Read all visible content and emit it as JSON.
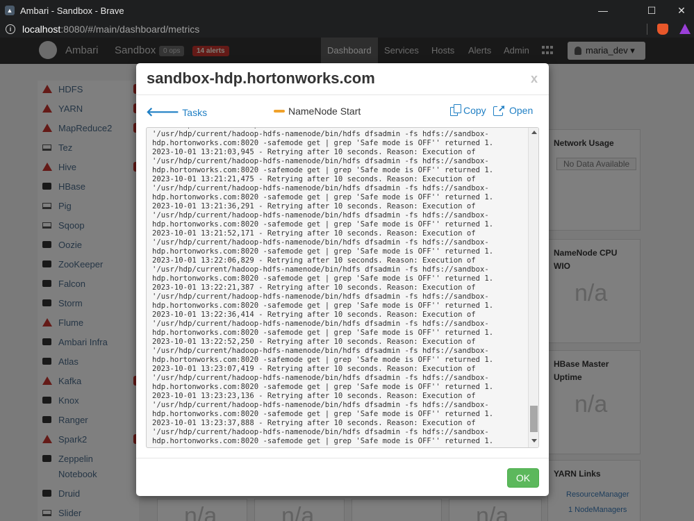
{
  "browser": {
    "window_title": "Ambari - Sandbox - Brave",
    "url_host": "localhost",
    "url_path": ":8080/#/main/dashboard/metrics",
    "minimize": "—",
    "maximize": "☐",
    "close": "✕"
  },
  "app": {
    "brand": "Ambari",
    "cluster": "Sandbox",
    "ops_badge": "0 ops",
    "alerts_badge": "14 alerts",
    "nav": [
      "Dashboard",
      "Services",
      "Hosts",
      "Alerts",
      "Admin"
    ],
    "user": "maria_dev ▾"
  },
  "sidebar": {
    "services": [
      {
        "label": "HDFS",
        "icon": "warning-icon"
      },
      {
        "label": "YARN",
        "icon": "warning-icon"
      },
      {
        "label": "MapReduce2",
        "icon": "warning-icon"
      },
      {
        "label": "Tez",
        "icon": "laptop-icon"
      },
      {
        "label": "Hive",
        "icon": "warning-icon"
      },
      {
        "label": "HBase",
        "icon": "briefcase-icon"
      },
      {
        "label": "Pig",
        "icon": "laptop-icon"
      },
      {
        "label": "Sqoop",
        "icon": "laptop-icon"
      },
      {
        "label": "Oozie",
        "icon": "briefcase-icon"
      },
      {
        "label": "ZooKeeper",
        "icon": "briefcase-icon"
      },
      {
        "label": "Falcon",
        "icon": "briefcase-icon"
      },
      {
        "label": "Storm",
        "icon": "briefcase-icon"
      },
      {
        "label": "Flume",
        "icon": "warning-icon"
      },
      {
        "label": "Ambari Infra",
        "icon": "briefcase-icon"
      },
      {
        "label": "Atlas",
        "icon": "briefcase-icon"
      },
      {
        "label": "Kafka",
        "icon": "warning-icon"
      },
      {
        "label": "Knox",
        "icon": "briefcase-icon"
      },
      {
        "label": "Ranger",
        "icon": "briefcase-icon"
      },
      {
        "label": "Spark2",
        "icon": "warning-icon"
      },
      {
        "label": "Zeppelin",
        "icon": "briefcase-icon"
      },
      {
        "label": "Notebook",
        "icon": ""
      },
      {
        "label": "Druid",
        "icon": "briefcase-icon"
      },
      {
        "label": "Slider",
        "icon": "laptop-icon"
      }
    ]
  },
  "dashboard": {
    "network_usage": "Network Usage",
    "no_data": "No Data Available",
    "namenode_cpu": "NameNode CPU WIO",
    "hbase_uptime": "HBase Master Uptime",
    "na": "n/a",
    "yarn_links": "YARN Links",
    "resource_manager": "ResourceManager",
    "node_managers": "1 NodeManagers"
  },
  "modal": {
    "title": "sandbox-hdp.hortonworks.com",
    "close": "x",
    "back_label": "Tasks",
    "task_name": "NameNode Start",
    "copy_label": "Copy",
    "open_label": "Open",
    "ok_label": "OK",
    "log": "'/usr/hdp/current/hadoop-hdfs-namenode/bin/hdfs dfsadmin -fs hdfs://sandbox-\n'/usr/hdp/current/hadoop-hdfs-namenode/bin/hdfs dfsadmin -fs hdfs://sandbox-\nhdp.hortonworks.com:8020 -safemode get | grep 'Safe mode is OFF'' returned 1.\n2023-10-01 13:21:03,945 - Retrying after 10 seconds. Reason: Execution of\n'/usr/hdp/current/hadoop-hdfs-namenode/bin/hdfs dfsadmin -fs hdfs://sandbox-\nhdp.hortonworks.com:8020 -safemode get | grep 'Safe mode is OFF'' returned 1.\n2023-10-01 13:21:21,475 - Retrying after 10 seconds. Reason: Execution of\n'/usr/hdp/current/hadoop-hdfs-namenode/bin/hdfs dfsadmin -fs hdfs://sandbox-\nhdp.hortonworks.com:8020 -safemode get | grep 'Safe mode is OFF'' returned 1.\n2023-10-01 13:21:36,291 - Retrying after 10 seconds. Reason: Execution of\n'/usr/hdp/current/hadoop-hdfs-namenode/bin/hdfs dfsadmin -fs hdfs://sandbox-\nhdp.hortonworks.com:8020 -safemode get | grep 'Safe mode is OFF'' returned 1.\n2023-10-01 13:21:52,171 - Retrying after 10 seconds. Reason: Execution of\n'/usr/hdp/current/hadoop-hdfs-namenode/bin/hdfs dfsadmin -fs hdfs://sandbox-\nhdp.hortonworks.com:8020 -safemode get | grep 'Safe mode is OFF'' returned 1.\n2023-10-01 13:22:06,829 - Retrying after 10 seconds. Reason: Execution of\n'/usr/hdp/current/hadoop-hdfs-namenode/bin/hdfs dfsadmin -fs hdfs://sandbox-\nhdp.hortonworks.com:8020 -safemode get | grep 'Safe mode is OFF'' returned 1.\n2023-10-01 13:22:21,387 - Retrying after 10 seconds. Reason: Execution of\n'/usr/hdp/current/hadoop-hdfs-namenode/bin/hdfs dfsadmin -fs hdfs://sandbox-\nhdp.hortonworks.com:8020 -safemode get | grep 'Safe mode is OFF'' returned 1.\n2023-10-01 13:22:36,414 - Retrying after 10 seconds. Reason: Execution of\n'/usr/hdp/current/hadoop-hdfs-namenode/bin/hdfs dfsadmin -fs hdfs://sandbox-\nhdp.hortonworks.com:8020 -safemode get | grep 'Safe mode is OFF'' returned 1.\n2023-10-01 13:22:52,250 - Retrying after 10 seconds. Reason: Execution of\n'/usr/hdp/current/hadoop-hdfs-namenode/bin/hdfs dfsadmin -fs hdfs://sandbox-\nhdp.hortonworks.com:8020 -safemode get | grep 'Safe mode is OFF'' returned 1.\n2023-10-01 13:23:07,419 - Retrying after 10 seconds. Reason: Execution of\n'/usr/hdp/current/hadoop-hdfs-namenode/bin/hdfs dfsadmin -fs hdfs://sandbox-\nhdp.hortonworks.com:8020 -safemode get | grep 'Safe mode is OFF'' returned 1.\n2023-10-01 13:23:23,136 - Retrying after 10 seconds. Reason: Execution of\n'/usr/hdp/current/hadoop-hdfs-namenode/bin/hdfs dfsadmin -fs hdfs://sandbox-\nhdp.hortonworks.com:8020 -safemode get | grep 'Safe mode is OFF'' returned 1.\n2023-10-01 13:23:37,888 - Retrying after 10 seconds. Reason: Execution of\n'/usr/hdp/current/hadoop-hdfs-namenode/bin/hdfs dfsadmin -fs hdfs://sandbox-\nhdp.hortonworks.com:8020 -safemode get | grep 'Safe mode is OFF'' returned 1."
  }
}
